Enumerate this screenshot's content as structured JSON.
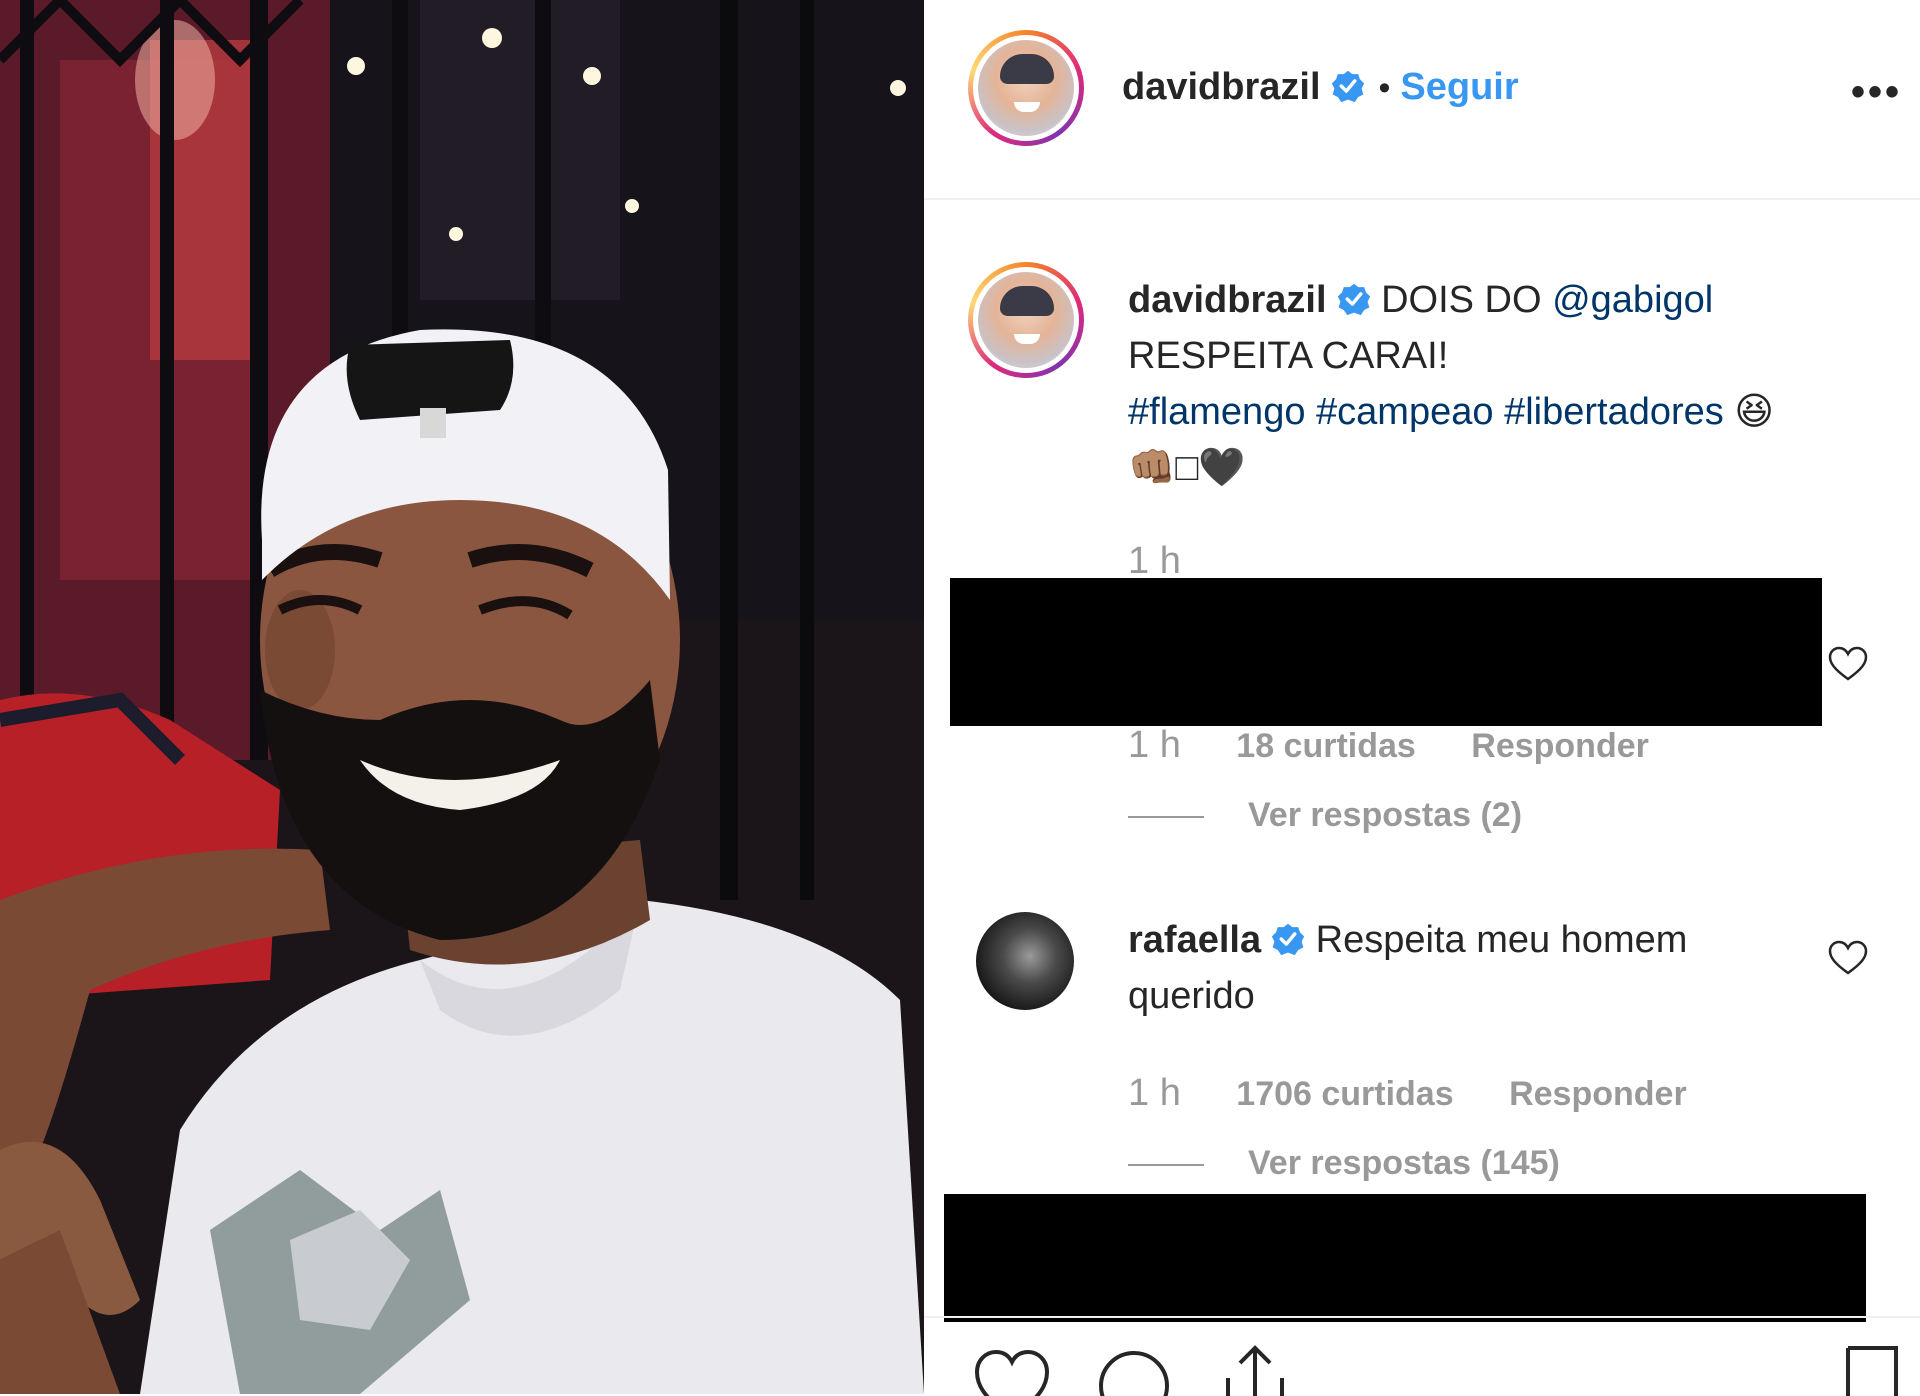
{
  "post": {
    "author": "davidbrazil",
    "separator": "•",
    "follow_label": "Seguir",
    "more_label": "•••"
  },
  "caption": {
    "author": "davidbrazil",
    "line1_prefix": "DOIS DO ",
    "mention": "@gabigol",
    "line2": "RESPEITA CARAI!",
    "hashtags": [
      "#flamengo",
      "#campeao",
      "#libertadores"
    ],
    "emoji_line1": "😆",
    "emoji_line2": "👊🏽□🖤",
    "time": "1 h"
  },
  "comments": [
    {
      "redacted": true,
      "time": "1 h",
      "likes": "18 curtidas",
      "reply_label": "Responder",
      "view_replies": "Ver respostas (2)"
    },
    {
      "author": "rafaella",
      "text_line1": "Respeita meu homem",
      "text_line2": "querido",
      "time": "1 h",
      "likes": "1706 curtidas",
      "reply_label": "Responder",
      "view_replies": "Ver respostas (145)"
    }
  ],
  "colors": {
    "link": "#003569",
    "follow": "#3897f0",
    "verified": "#3897f0",
    "muted": "#999999"
  },
  "icons": [
    "verified-badge-icon",
    "heart-icon",
    "comment-icon",
    "share-icon",
    "bookmark-icon",
    "more-icon"
  ]
}
